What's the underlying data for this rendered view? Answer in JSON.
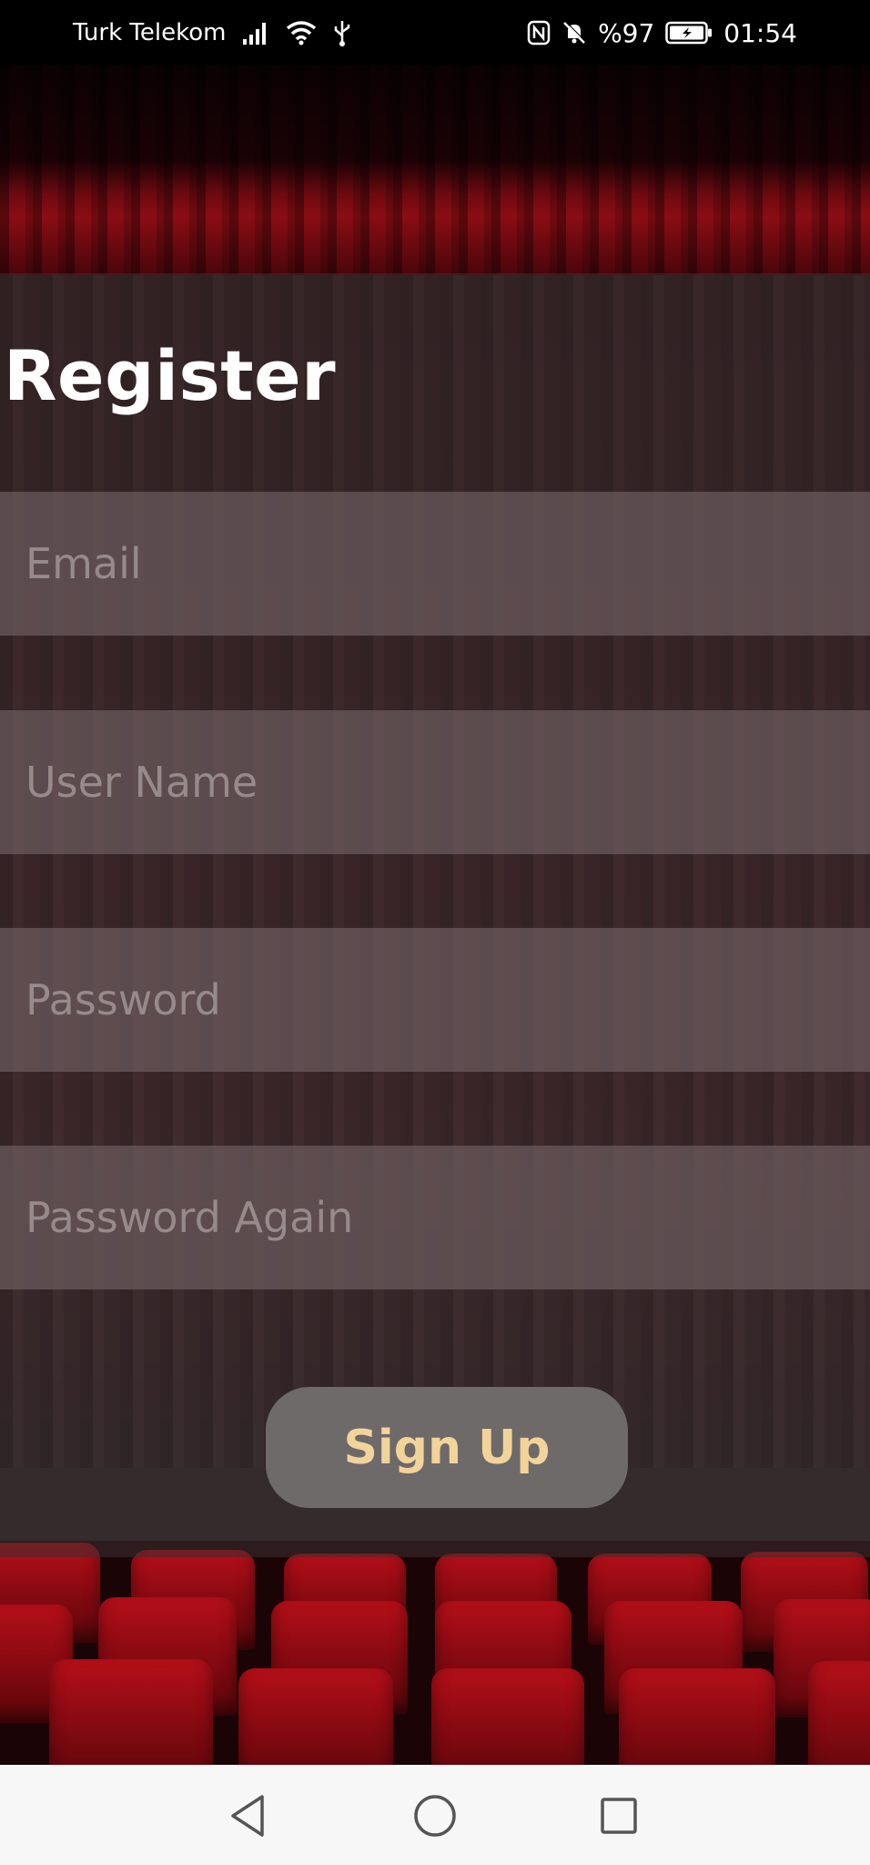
{
  "status_bar": {
    "carrier": "Turk Telekom",
    "battery": "%97",
    "time": "01:54",
    "icons": [
      "signal-icon",
      "wifi-icon",
      "usb-icon",
      "nfc-icon",
      "bell-muted-icon",
      "battery-icon"
    ]
  },
  "register": {
    "title": "Register",
    "fields": {
      "email_placeholder": "Email",
      "username_placeholder": "User Name",
      "password_placeholder": "Password",
      "password_again_placeholder": "Password Again"
    },
    "signup_label": "Sign Up"
  },
  "colors": {
    "button_text": "#f2d49a",
    "button_bg": "#6e6a6a",
    "placeholder": "#968a8b"
  },
  "nav_bar": {
    "buttons": [
      "back-icon",
      "home-icon",
      "recents-icon"
    ]
  }
}
